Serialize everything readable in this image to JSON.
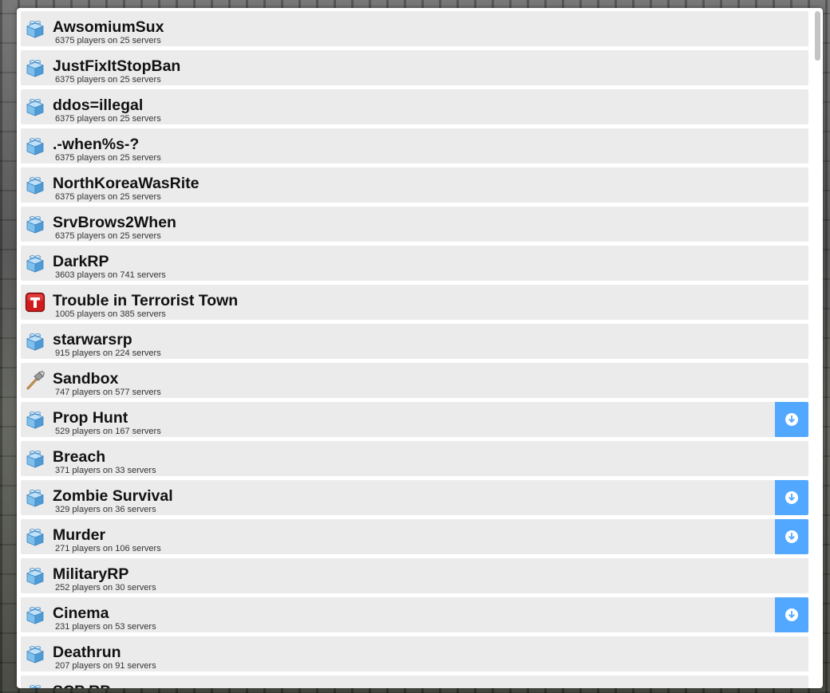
{
  "gamemodes": [
    {
      "name": "AwsomiumSux",
      "stats": "6375 players on 25 servers",
      "icon": "lego-brick-icon",
      "download": false
    },
    {
      "name": "JustFixItStopBan",
      "stats": "6375 players on 25 servers",
      "icon": "lego-brick-icon",
      "download": false
    },
    {
      "name": "ddos=illegal",
      "stats": "6375 players on 25 servers",
      "icon": "lego-brick-icon",
      "download": false
    },
    {
      "name": ".-when%s-?",
      "stats": "6375 players on 25 servers",
      "icon": "lego-brick-icon",
      "download": false
    },
    {
      "name": "NorthKoreaWasRite",
      "stats": "6375 players on 25 servers",
      "icon": "lego-brick-icon",
      "download": false
    },
    {
      "name": "SrvBrows2When",
      "stats": "6375 players on 25 servers",
      "icon": "lego-brick-icon",
      "download": false
    },
    {
      "name": "DarkRP",
      "stats": "3603 players on 741 servers",
      "icon": "lego-brick-icon",
      "download": false
    },
    {
      "name": "Trouble in Terrorist Town",
      "stats": "1005 players on 385 servers",
      "icon": "ttt-icon",
      "download": false
    },
    {
      "name": "starwarsrp",
      "stats": "915 players on 224 servers",
      "icon": "lego-brick-icon",
      "download": false
    },
    {
      "name": "Sandbox",
      "stats": "747 players on 577 servers",
      "icon": "hammer-icon",
      "download": false
    },
    {
      "name": "Prop Hunt",
      "stats": "529 players on 167 servers",
      "icon": "lego-brick-icon",
      "download": true
    },
    {
      "name": "Breach",
      "stats": "371 players on 33 servers",
      "icon": "lego-brick-icon",
      "download": false
    },
    {
      "name": "Zombie Survival",
      "stats": "329 players on 36 servers",
      "icon": "lego-brick-icon",
      "download": true
    },
    {
      "name": "Murder",
      "stats": "271 players on 106 servers",
      "icon": "lego-brick-icon",
      "download": true
    },
    {
      "name": "MilitaryRP",
      "stats": "252 players on 30 servers",
      "icon": "lego-brick-icon",
      "download": false
    },
    {
      "name": "Cinema",
      "stats": "231 players on 53 servers",
      "icon": "lego-brick-icon",
      "download": true
    },
    {
      "name": "Deathrun",
      "stats": "207 players on 91 servers",
      "icon": "lego-brick-icon",
      "download": false
    },
    {
      "name": "SCP RP",
      "stats": "",
      "icon": "lego-brick-icon",
      "download": false
    }
  ],
  "colors": {
    "row_background": "#ebebeb",
    "download_button": "#52a8ff",
    "brick_blue": "#5ba7dd",
    "ttt_red": "#d01c1c"
  }
}
